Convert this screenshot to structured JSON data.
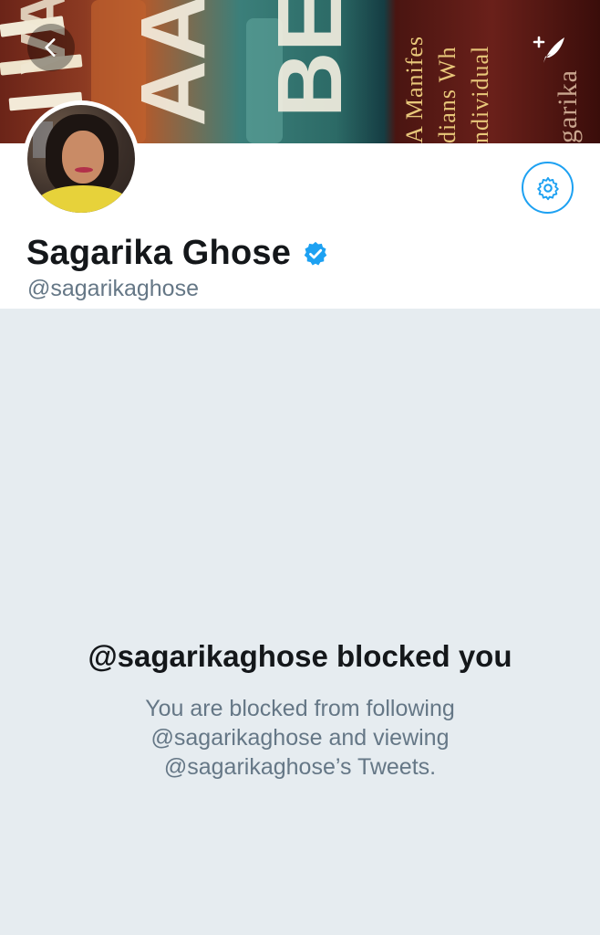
{
  "header": {
    "banner_text_lines": [
      "A Manifes",
      "dians Wh",
      "ndividual",
      "garika"
    ],
    "banner_big_text": [
      "VA",
      "AA",
      "BE"
    ],
    "back_icon": "chevron-left-icon",
    "compose_icon": "compose-tweet-icon"
  },
  "profile": {
    "display_name": "Sagarika Ghose",
    "handle": "@sagarikaghose",
    "verified": true,
    "settings_icon": "gear-icon"
  },
  "blocked": {
    "title": "@sagarikaghose blocked you",
    "description": "You are blocked from following @sagarikaghose and viewing @sagarikaghose’s Tweets."
  },
  "colors": {
    "accent": "#1da1f2",
    "text_primary": "#14171a",
    "text_secondary": "#657786",
    "blocked_background": "#e6ecf0"
  }
}
